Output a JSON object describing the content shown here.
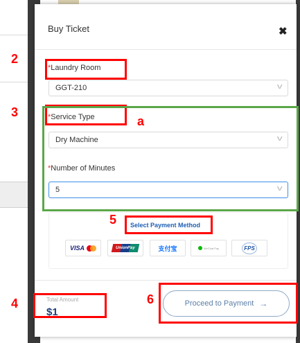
{
  "modal": {
    "title": "Buy Ticket",
    "close_glyph": "✖"
  },
  "form": {
    "laundry_room": {
      "required_mark": "*",
      "label": "Laundry Room",
      "value": "GGT-210"
    },
    "service_type": {
      "required_mark": "*",
      "label": "Service Type",
      "value": "Dry Machine"
    },
    "minutes": {
      "required_mark": "*",
      "label": "Number of Minutes",
      "value": "5"
    },
    "chevron_glyph": "v"
  },
  "payment": {
    "label": "Select Payment Method",
    "methods": [
      {
        "name": "visa-mastercard",
        "text": "VISA"
      },
      {
        "name": "unionpay",
        "text": "UnionPay"
      },
      {
        "name": "alipay",
        "text": "支付宝"
      },
      {
        "name": "wechat-pay",
        "text": "WeChat Pay"
      },
      {
        "name": "fps",
        "text": "FPS"
      }
    ]
  },
  "footer": {
    "total_label": "Total Amount",
    "total_amount": "$1",
    "proceed_label": "Proceed to Payment",
    "proceed_arrow": "→"
  },
  "annotations": {
    "step_2": "2",
    "step_3": "3",
    "step_a": "a",
    "step_4": "4",
    "step_5": "5",
    "step_6": "6"
  },
  "colors": {
    "required": "#e53935",
    "annotation_red": "#ff0000",
    "annotation_green": "#5aa648",
    "link_blue": "#1f5fb3",
    "total_blue": "#1d3f7a",
    "active_border": "#3d8ee8"
  }
}
